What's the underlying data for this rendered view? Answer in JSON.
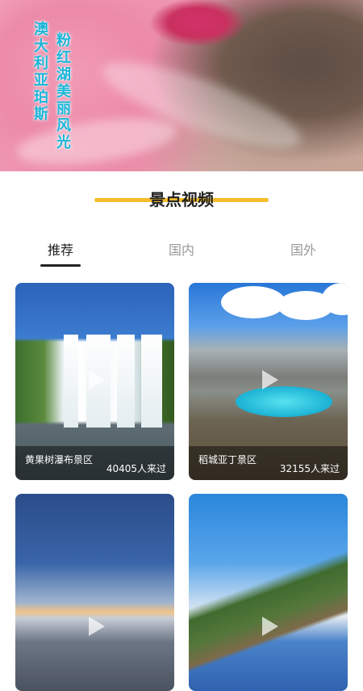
{
  "hero": {
    "title_line1": "澳大利亚珀斯",
    "title_line2": "粉红湖美丽风光"
  },
  "section": {
    "title": "景点视频"
  },
  "tabs": [
    {
      "label": "推荐",
      "active": true
    },
    {
      "label": "国内",
      "active": false
    },
    {
      "label": "国外",
      "active": false
    }
  ],
  "cards": [
    {
      "name": "黄果树瀑布景区",
      "count": "40405人来过",
      "scene": "waterfall"
    },
    {
      "name": "稻城亚丁景区",
      "count": "32155人来过",
      "scene": "mountain-lake"
    },
    {
      "name": "",
      "count": "",
      "scene": "city-dusk"
    },
    {
      "name": "",
      "count": "",
      "scene": "blue-town"
    }
  ],
  "colors": {
    "accent": "#f4bd2b",
    "hero_text": "#1bb6d8",
    "tab_active": "#222222",
    "tab_inactive": "#999999"
  }
}
